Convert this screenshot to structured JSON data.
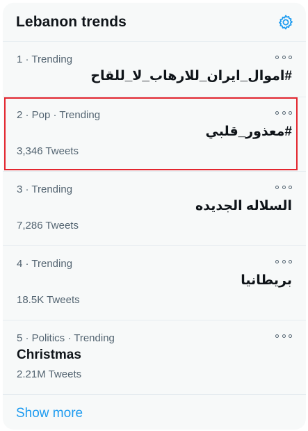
{
  "header": {
    "title": "Lebanon trends"
  },
  "colors": {
    "accent": "#1d9bf0",
    "highlight": "#e3262f",
    "muted": "#536471"
  },
  "trends": [
    {
      "meta": "1 · Trending",
      "name": "#اموال_ايران_للارهاب_لا_للقاح",
      "tweets": ""
    },
    {
      "meta": "2 · Pop · Trending",
      "name": "#معذور_قلبي",
      "tweets": "3,346 Tweets"
    },
    {
      "meta": "3 · Trending",
      "name": "السلاله الجديده",
      "tweets": "7,286 Tweets"
    },
    {
      "meta": "4 · Trending",
      "name": "بريطانيا",
      "tweets": "18.5K Tweets"
    },
    {
      "meta": "5 · Politics · Trending",
      "name": "Christmas",
      "tweets": "2.21M Tweets"
    }
  ],
  "footer": {
    "show_more": "Show more"
  },
  "icons": {
    "settings": "gear-icon",
    "more": "more-options-icon"
  }
}
